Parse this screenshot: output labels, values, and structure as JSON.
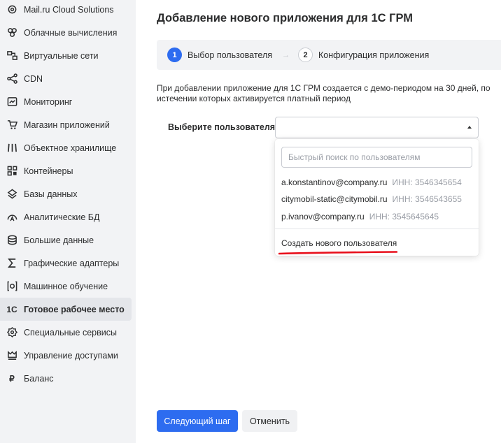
{
  "sidebar": {
    "items": [
      {
        "label": "Mail.ru Cloud Solutions",
        "icon": "settings-gear-icon"
      },
      {
        "label": "Облачные вычисления",
        "icon": "cloud-compute-icon"
      },
      {
        "label": "Виртуальные сети",
        "icon": "network-icon"
      },
      {
        "label": "CDN",
        "icon": "cdn-share-icon"
      },
      {
        "label": "Мониторинг",
        "icon": "monitoring-icon"
      },
      {
        "label": "Магазин приложений",
        "icon": "shop-cart-icon"
      },
      {
        "label": "Объектное хранилище",
        "icon": "object-storage-icon"
      },
      {
        "label": "Контейнеры",
        "icon": "containers-icon"
      },
      {
        "label": "Базы данных",
        "icon": "database-icon"
      },
      {
        "label": "Аналитические БД",
        "icon": "analytics-db-icon"
      },
      {
        "label": "Большие данные",
        "icon": "big-data-icon"
      },
      {
        "label": "Графические адаптеры",
        "icon": "sigma-gpu-icon"
      },
      {
        "label": "Машинное обучение",
        "icon": "machine-learning-icon"
      },
      {
        "label": "Готовое рабочее место",
        "icon": "1c-icon",
        "icon_text": "1С",
        "active": true
      },
      {
        "label": "Специальные сервисы",
        "icon": "special-services-icon"
      },
      {
        "label": "Управление доступами",
        "icon": "access-crown-icon"
      },
      {
        "label": "Баланс",
        "icon": "ruble-icon",
        "icon_text": "₽"
      }
    ]
  },
  "page": {
    "title": "Добавление нового приложения для 1С ГРМ",
    "description": "При добавлении приложение для 1С ГРМ создается с демо-периодом на 30 дней, по истечении которых активируется платный период"
  },
  "stepper": {
    "step1": {
      "num": "1",
      "label": "Выбор пользователя"
    },
    "arrow": "→",
    "step2": {
      "num": "2",
      "label": "Конфигурация приложения"
    }
  },
  "form": {
    "user_label": "Выберите пользователя",
    "user_value": ""
  },
  "dropdown": {
    "search_placeholder": "Быстрый поиск по пользователям",
    "options": [
      {
        "email": "a.konstantinov@company.ru",
        "inn": "ИНН: 3546345654"
      },
      {
        "email": "citymobil-static@citymobil.ru",
        "inn": "ИНН: 3546543655"
      },
      {
        "email": "p.ivanov@company.ru",
        "inn": "ИНН: 3545645645"
      }
    ],
    "create_label": "Создать нового пользователя"
  },
  "buttons": {
    "next": "Следующий шаг",
    "cancel": "Отменить"
  },
  "colors": {
    "accent": "#2d6cf0",
    "sidebar_bg": "#f2f3f5",
    "annotation_underline": "#e8101c"
  }
}
